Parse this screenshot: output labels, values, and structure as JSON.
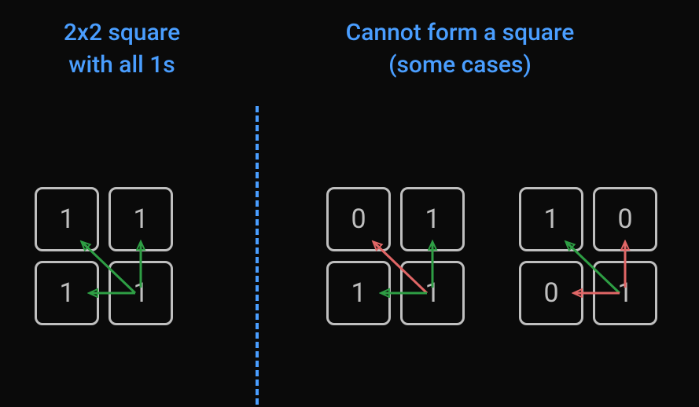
{
  "headings": {
    "left_line1": "2x2 square",
    "left_line2": "with all 1s",
    "right_line1": "Cannot form a square",
    "right_line2": "(some cases)"
  },
  "grids": [
    {
      "name": "all-ones",
      "cells": {
        "tl": "1",
        "tr": "1",
        "bl": "1",
        "br": "1"
      },
      "arrows": [
        {
          "to": "tl",
          "color": "green"
        },
        {
          "to": "tr",
          "color": "green"
        },
        {
          "to": "bl",
          "color": "green"
        }
      ]
    },
    {
      "name": "zero-top-left",
      "cells": {
        "tl": "0",
        "tr": "1",
        "bl": "1",
        "br": "1"
      },
      "arrows": [
        {
          "to": "tl",
          "color": "red"
        },
        {
          "to": "tr",
          "color": "green"
        },
        {
          "to": "bl",
          "color": "green"
        }
      ]
    },
    {
      "name": "zeros-tr-bl",
      "cells": {
        "tl": "1",
        "tr": "0",
        "bl": "0",
        "br": "1"
      },
      "arrows": [
        {
          "to": "tl",
          "color": "green"
        },
        {
          "to": "tr",
          "color": "red"
        },
        {
          "to": "bl",
          "color": "red"
        }
      ]
    }
  ],
  "colors": {
    "green": "#2e9e44",
    "red": "#e06666",
    "accent": "#4a9eff",
    "cell_border": "#bfbfbf"
  }
}
